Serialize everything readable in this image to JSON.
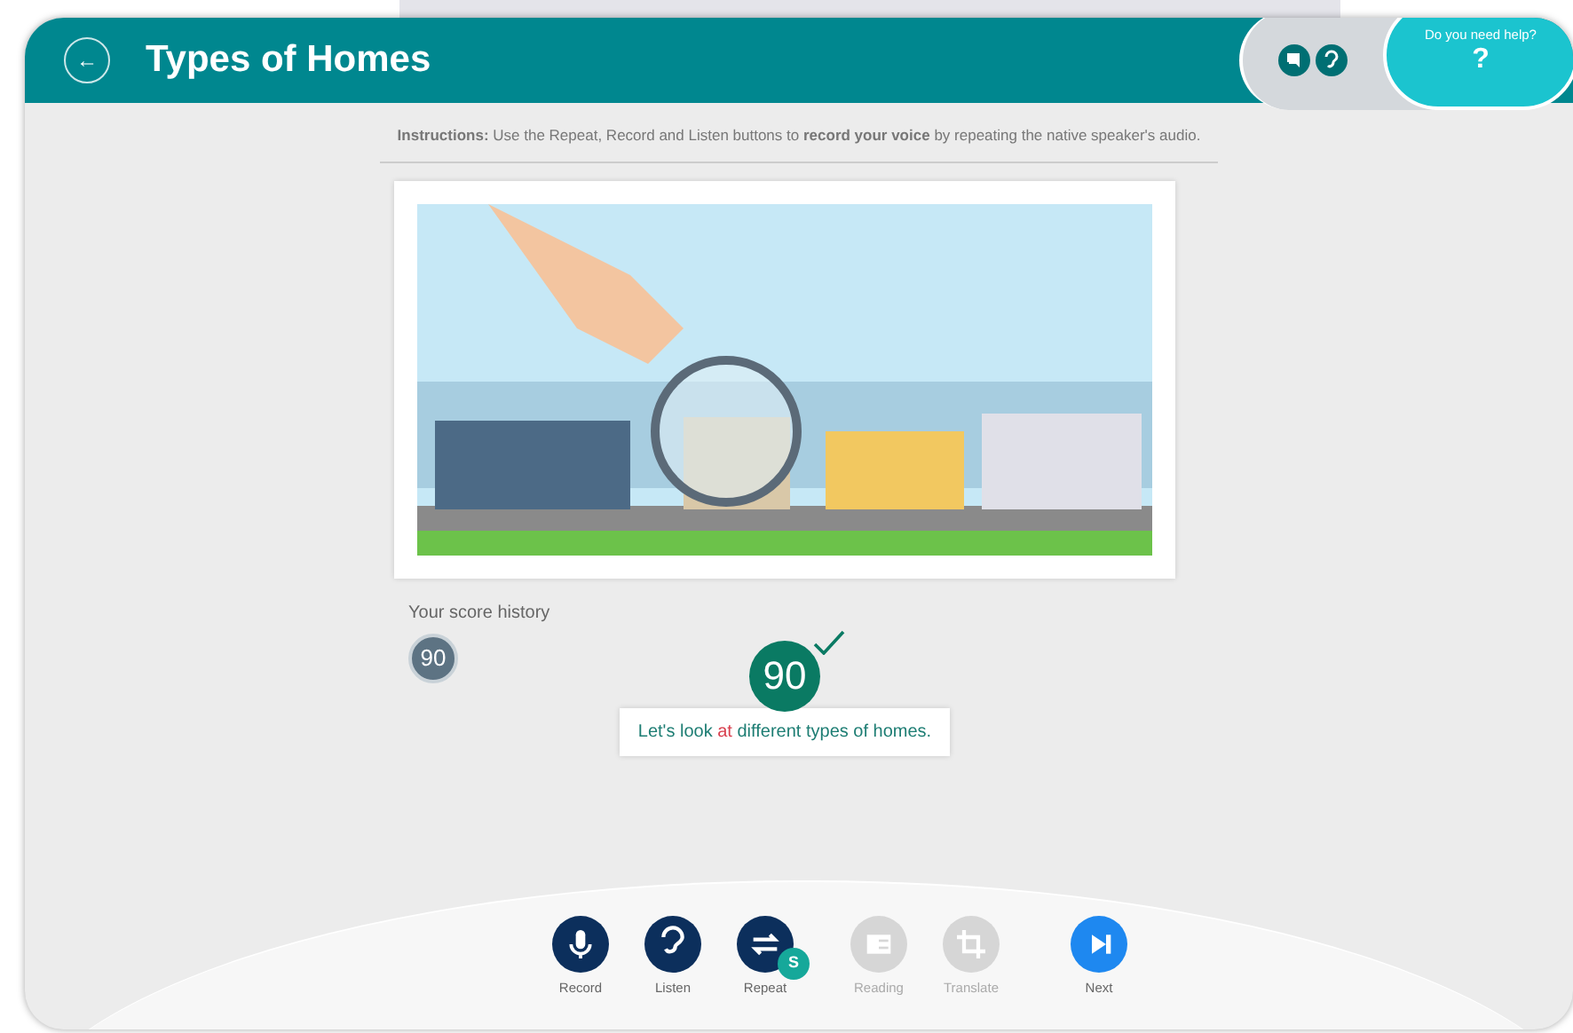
{
  "header": {
    "back_icon": "←",
    "title": "Types of Homes"
  },
  "help": {
    "label": "Do you need help?",
    "mark": "?"
  },
  "instructions": "**Instructions:** Use the Repeat, Record and Listen buttons to **record your voice** by repeating the native speaker's audio.",
  "score_history": {
    "label": "Your score history",
    "scores": [
      "90"
    ]
  },
  "result": {
    "score": "90",
    "passed": true
  },
  "sentence": [
    {
      "text": "Let's",
      "kind": "good"
    },
    {
      "text": "look",
      "kind": "good"
    },
    {
      "text": "at",
      "kind": "bad"
    },
    {
      "text": "different",
      "kind": "good"
    },
    {
      "text": "types",
      "kind": "good"
    },
    {
      "text": "of",
      "kind": "good"
    },
    {
      "text": "homes.",
      "kind": "good"
    }
  ],
  "toolbar": [
    {
      "kind": "record",
      "label": "Record",
      "disabled": false
    },
    {
      "kind": "listen",
      "label": "Listen",
      "disabled": false
    },
    {
      "kind": "repeat",
      "label": "Repeat",
      "disabled": false,
      "badge": "S"
    },
    {
      "kind": "reading",
      "label": "Reading",
      "disabled": true
    },
    {
      "kind": "translate",
      "label": "Translate",
      "disabled": true
    },
    {
      "kind": "next",
      "label": "Next",
      "disabled": false
    }
  ]
}
